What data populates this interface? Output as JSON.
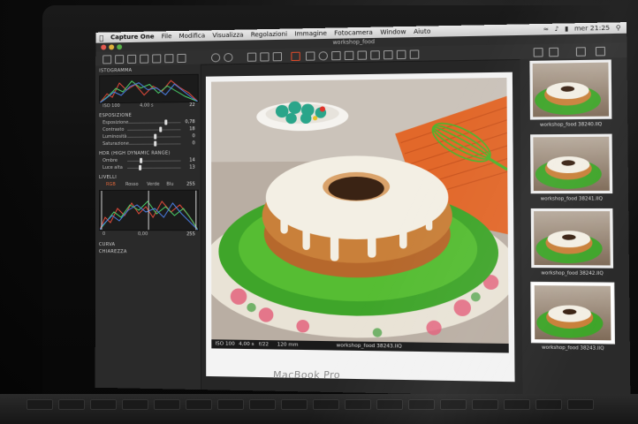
{
  "menubar": {
    "app_name": "Capture One",
    "items": [
      "File",
      "Modifica",
      "Visualizza",
      "Regolazioni",
      "Immagine",
      "Fotocamera",
      "Window",
      "Aiuto"
    ],
    "clock": "mer 21:25"
  },
  "window": {
    "title": "workshop_food"
  },
  "left_panel": {
    "histogram_title": "ISTOGRAMMA",
    "iso": "ISO 100",
    "shutter": "4,00 s",
    "aperture_short": "22",
    "exposure_title": "ESPOSIZIONE",
    "exposure_rows": [
      {
        "label": "Esposizione",
        "value": "0,78"
      },
      {
        "label": "Contrasto",
        "value": "18"
      },
      {
        "label": "Luminosità",
        "value": "0"
      },
      {
        "label": "Saturazione",
        "value": "0"
      }
    ],
    "hdr_title": "HDR (HIGH DYNAMIC RANGE)",
    "hdr_rows": [
      {
        "label": "Ombre",
        "value": "14"
      },
      {
        "label": "Luce alta",
        "value": "13"
      }
    ],
    "levels_title": "LIVELLI",
    "levels_tabs": [
      "RGB",
      "Rosso",
      "Verde",
      "Blu"
    ],
    "levels_min": "0",
    "levels_mid": "0,00",
    "levels_max": "255",
    "levels_max_top": "255",
    "curve_title": "CURVA",
    "clarity_title": "CHIAREZZA"
  },
  "viewer": {
    "iso": "ISO 100",
    "shutter": "4,00 s",
    "aperture": "f/22",
    "focal": "120 mm",
    "filename": "workshop_food 38243.IIQ"
  },
  "browser": {
    "thumbs": [
      {
        "caption": "workshop_food 38240.IIQ"
      },
      {
        "caption": "workshop_food 38241.IIQ"
      },
      {
        "caption": "workshop_food 38242.IIQ"
      },
      {
        "caption": "workshop_food 38243.IIQ"
      }
    ]
  },
  "laptop": {
    "brand_label": "MacBook Pro"
  },
  "colors": {
    "plate_green": "#3fa52a",
    "cake": "#c9803a",
    "icing": "#f3efe4",
    "mat_orange": "#e2682a",
    "accent_red": "#e04b2a"
  }
}
